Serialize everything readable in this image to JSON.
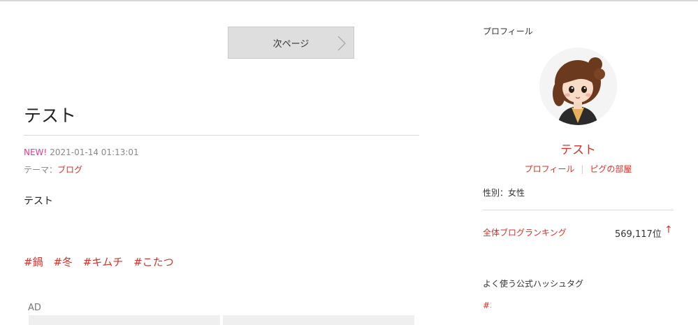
{
  "pager": {
    "next_label": "次ページ"
  },
  "article": {
    "title": "テスト",
    "new_badge": "NEW!",
    "datetime": "2021-01-14 01:13:01",
    "theme_prefix": "テーマ：",
    "theme_link": "ブログ",
    "body": "テスト",
    "hashtags": [
      "#鍋",
      "#冬",
      "#キムチ",
      "#こたつ"
    ]
  },
  "ad": {
    "label": "AD"
  },
  "sidebar": {
    "heading": "プロフィール",
    "name": "テスト",
    "links": [
      "プロフィール",
      "ピグの部屋"
    ],
    "gender": "性別：女性",
    "ranking_label": "全体ブログランキング",
    "ranking_value": "569,117位",
    "ranking_arrow": "↑",
    "official_heading": "よく使う公式ハッシュタグ",
    "official_tag": "#オ"
  },
  "colors": {
    "accent": "#d2322a",
    "new_badge": "#e8368f",
    "button_bg": "#dedede"
  }
}
